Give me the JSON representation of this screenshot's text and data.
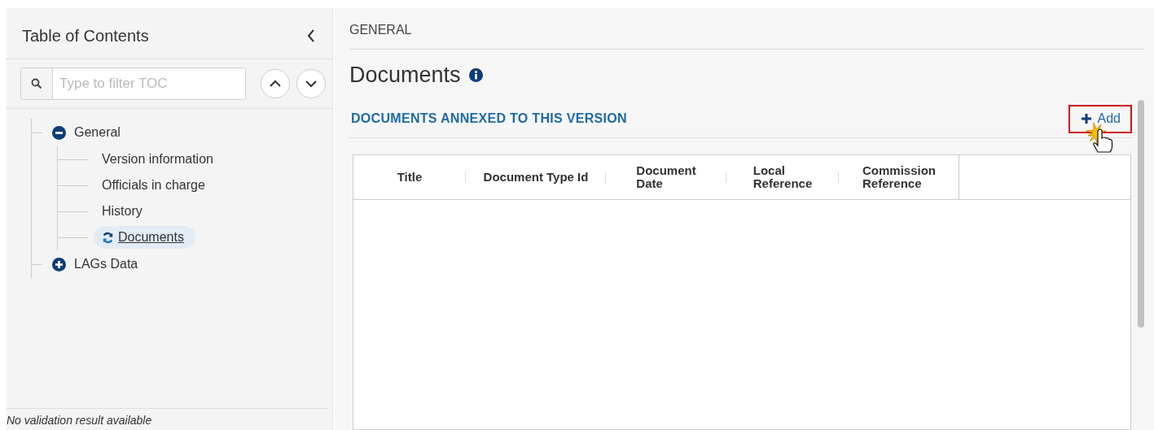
{
  "sidebar": {
    "title": "Table of Contents",
    "filter": {
      "placeholder": "Type to filter TOC"
    },
    "tree": [
      {
        "label": "General",
        "expanded": true,
        "children": [
          {
            "label": "Version information",
            "selected": false
          },
          {
            "label": "Officials in charge",
            "selected": false
          },
          {
            "label": "History",
            "selected": false
          },
          {
            "label": "Documents",
            "selected": true
          }
        ]
      },
      {
        "label": "LAGs Data",
        "expanded": false
      }
    ],
    "status": "No validation result available"
  },
  "breadcrumb": "GENERAL",
  "page_title": "Documents",
  "section": {
    "title": "DOCUMENTS ANNEXED TO THIS VERSION",
    "add_button": "Add",
    "table": {
      "columns": [
        "Title",
        "Document Type Id",
        "Document\nDate",
        "Local\nReference",
        "Commission\nReference"
      ]
    }
  }
}
